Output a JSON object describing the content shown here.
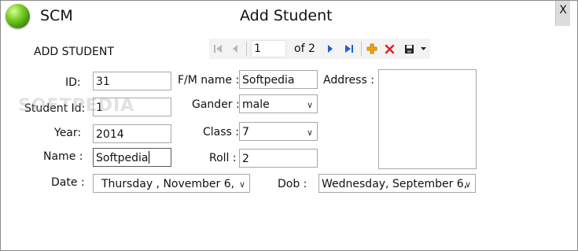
{
  "window": {
    "app_name": "SCM",
    "title": "Add Student",
    "close_label": "X"
  },
  "section_title": "ADD STUDENT",
  "navigator": {
    "position": "1",
    "count_label": "of 2"
  },
  "form": {
    "id": {
      "label": "ID:",
      "value": "31"
    },
    "student_id": {
      "label": "Student Id:",
      "value": "1"
    },
    "year": {
      "label": "Year:",
      "value": "2014"
    },
    "name": {
      "label": "Name :",
      "value": "Softpedia"
    },
    "fm_name": {
      "label": "F/M name :",
      "value": "Softpedia"
    },
    "gander": {
      "label": "Gander :",
      "value": "male"
    },
    "class": {
      "label": "Class :",
      "value": "7"
    },
    "roll": {
      "label": "Roll :",
      "value": "2"
    },
    "address": {
      "label": "Address :",
      "value": ""
    },
    "date": {
      "label": "Date :",
      "value": "Thursday  , November   6,"
    },
    "dob": {
      "label": "Dob :",
      "value": "Wednesday, September   6,"
    }
  },
  "watermark": "SOFTPEDIA",
  "colors": {
    "accent_blue": "#1f5fd0",
    "add_orange": "#f0a400",
    "delete_red": "#e02020",
    "orb_green": "#5cb515"
  }
}
